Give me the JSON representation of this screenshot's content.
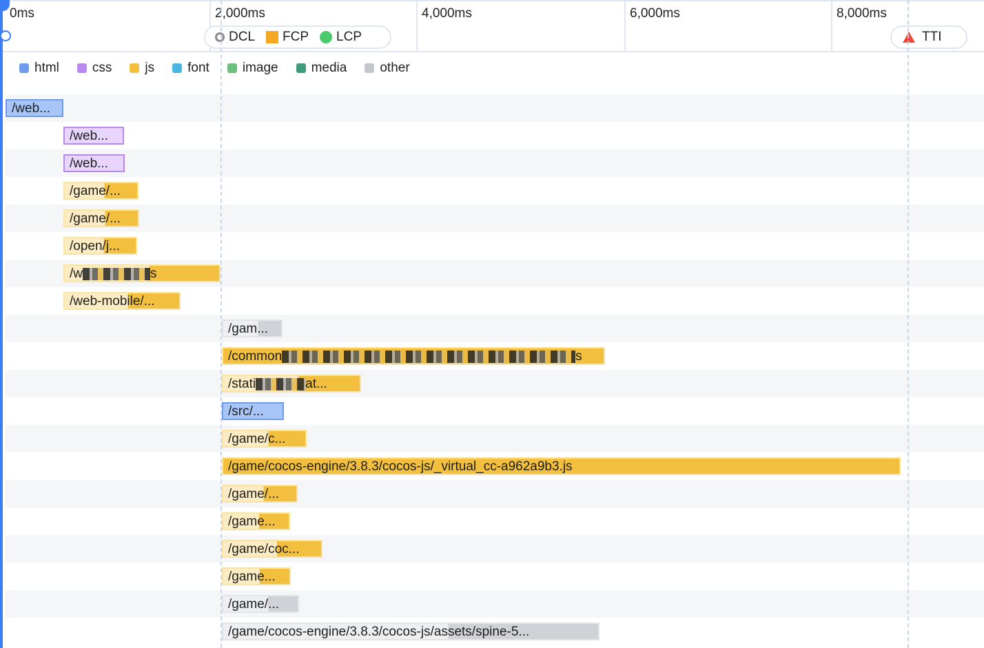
{
  "axis": {
    "ticks": [
      "0ms",
      "2,000ms",
      "4,000ms",
      "6,000ms",
      "8,000ms"
    ]
  },
  "markers": {
    "dcl": {
      "label": "DCL",
      "icon": "hollow-circle-icon"
    },
    "fcp": {
      "label": "FCP",
      "icon": "orange-square-icon"
    },
    "lcp": {
      "label": "LCP",
      "icon": "green-circle-icon"
    },
    "tti": {
      "label": "TTI",
      "icon": "red-triangle-icon"
    }
  },
  "legend": [
    {
      "label": "html",
      "color": "#6f9bed"
    },
    {
      "label": "css",
      "color": "#b988ef"
    },
    {
      "label": "js",
      "color": "#f2bf3f"
    },
    {
      "label": "font",
      "color": "#4bb6e0"
    },
    {
      "label": "image",
      "color": "#6cbf7c"
    },
    {
      "label": "media",
      "color": "#3f9b7a"
    },
    {
      "label": "other",
      "color": "#c4c7cc"
    }
  ],
  "requests": [
    {
      "label": "/web...",
      "type": "html"
    },
    {
      "label": "/web...",
      "type": "css"
    },
    {
      "label": "/web...",
      "type": "css"
    },
    {
      "label": "/game/...",
      "type": "js"
    },
    {
      "label": "/game/...",
      "type": "js"
    },
    {
      "label": "/open/j...",
      "type": "js"
    },
    {
      "label": "/w",
      "suffix": "s",
      "type": "js",
      "redacted": true
    },
    {
      "label": "/web-mobile/...",
      "type": "js"
    },
    {
      "label": "/gam...",
      "type": "other"
    },
    {
      "label": "/common",
      "suffix": "s",
      "type": "js",
      "redacted": true
    },
    {
      "label": "/stati",
      "suffix": "at...",
      "type": "js",
      "redacted": true
    },
    {
      "label": "/src/...",
      "type": "html"
    },
    {
      "label": "/game/c...",
      "type": "js"
    },
    {
      "label": "/game/cocos-engine/3.8.3/cocos-js/_virtual_cc-a962a9b3.js",
      "type": "js"
    },
    {
      "label": "/game/...",
      "type": "js"
    },
    {
      "label": "/game...",
      "type": "js"
    },
    {
      "label": "/game/coc...",
      "type": "js"
    },
    {
      "label": "/game...",
      "type": "js"
    },
    {
      "label": "/game/...",
      "type": "other"
    },
    {
      "label": "/game/cocos-engine/3.8.3/cocos-js/assets/spine-5...",
      "type": "other"
    }
  ]
}
